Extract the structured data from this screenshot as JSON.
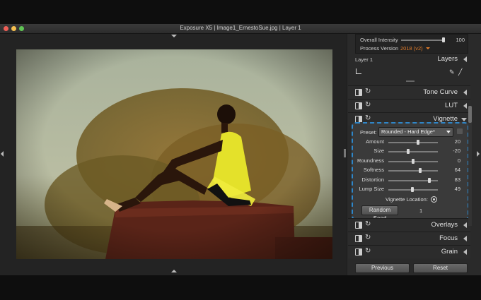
{
  "window": {
    "title": "Exposure X5 | Image1_ErnestoSue.jpg | Layer 1"
  },
  "top_panel": {
    "overall_intensity_label": "Overall Intensity",
    "overall_intensity_value": "100",
    "overall_intensity_fraction": 1.0,
    "process_version_label": "Process Version",
    "process_version_value": "2018 (v2)",
    "process_version_color": "#e07b2a"
  },
  "layers": {
    "layer_name": "Layer 1",
    "layers_label": "Layers"
  },
  "panels": [
    {
      "label": "Tone Curve"
    },
    {
      "label": "LUT"
    },
    {
      "label": "Vignette"
    },
    {
      "label": "Overlays"
    },
    {
      "label": "Focus"
    },
    {
      "label": "Grain"
    }
  ],
  "vignette": {
    "preset_label": "Preset:",
    "preset_value": "Rounded - Hard Edge*",
    "sliders": [
      {
        "label": "Amount",
        "value": "20",
        "fraction": 0.6
      },
      {
        "label": "Size",
        "value": "-20",
        "fraction": 0.4
      },
      {
        "label": "Roundness",
        "value": "0",
        "fraction": 0.5
      },
      {
        "label": "Softness",
        "value": "64",
        "fraction": 0.64
      },
      {
        "label": "Distortion",
        "value": "83",
        "fraction": 0.83
      },
      {
        "label": "Lump Size",
        "value": "49",
        "fraction": 0.49
      }
    ],
    "location_label": "Vignette Location:",
    "random_seed_label": "Random Seed",
    "random_seed_value": "1",
    "highlight_color": "#2f86c8"
  },
  "footer": {
    "previous_label": "Previous",
    "reset_label": "Reset"
  },
  "colors": {
    "photo_sky": "#b7bda4",
    "photo_dress": "#e4e12a",
    "photo_rock": "#5a2418"
  }
}
